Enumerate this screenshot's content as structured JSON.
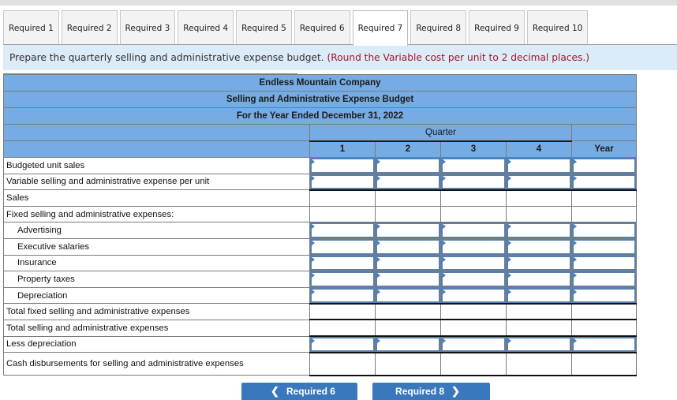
{
  "tabs": [
    {
      "label": "Required 1",
      "active": false
    },
    {
      "label": "Required 2",
      "active": false
    },
    {
      "label": "Required 3",
      "active": false
    },
    {
      "label": "Required 4",
      "active": false
    },
    {
      "label": "Required 5",
      "active": false
    },
    {
      "label": "Required 6",
      "active": false
    },
    {
      "label": "Required 7",
      "active": true
    },
    {
      "label": "Required 8",
      "active": false
    },
    {
      "label": "Required 9",
      "active": false
    },
    {
      "label": "Required 10",
      "active": false
    }
  ],
  "instruction": {
    "text": "Prepare the quarterly selling and administrative expense budget.",
    "note": "(Round the Variable cost per unit to 2 decimal places.)"
  },
  "budget": {
    "company": "Endless Mountain Company",
    "title": "Selling and Administrative Expense Budget",
    "period": "For the Year Ended December 31, 2022",
    "quarter_header": "Quarter",
    "columns": [
      "1",
      "2",
      "3",
      "4",
      "Year"
    ],
    "rows": [
      {
        "label": "Budgeted unit sales",
        "indent": false,
        "input": true,
        "values": [
          "",
          "",
          "",
          "",
          ""
        ]
      },
      {
        "label": "Variable selling and administrative expense per unit",
        "indent": false,
        "input": true,
        "values": [
          "",
          "",
          "",
          "",
          ""
        ]
      },
      {
        "label": "Sales",
        "indent": false,
        "input": false,
        "values": [
          "",
          "",
          "",
          "",
          ""
        ]
      },
      {
        "label": "Fixed selling and administrative expenses:",
        "indent": false,
        "input": false,
        "values": [
          "",
          "",
          "",
          "",
          ""
        ]
      },
      {
        "label": "Advertising",
        "indent": true,
        "input": true,
        "values": [
          "",
          "",
          "",
          "",
          ""
        ]
      },
      {
        "label": "Executive salaries",
        "indent": true,
        "input": true,
        "values": [
          "",
          "",
          "",
          "",
          ""
        ]
      },
      {
        "label": "Insurance",
        "indent": true,
        "input": true,
        "values": [
          "",
          "",
          "",
          "",
          ""
        ]
      },
      {
        "label": "Property taxes",
        "indent": true,
        "input": true,
        "values": [
          "",
          "",
          "",
          "",
          ""
        ]
      },
      {
        "label": "Depreciation",
        "indent": true,
        "input": true,
        "values": [
          "",
          "",
          "",
          "",
          ""
        ]
      },
      {
        "label": "Total fixed selling and administrative expenses",
        "indent": false,
        "input": false,
        "values": [
          "",
          "",
          "",
          "",
          ""
        ]
      },
      {
        "label": "Total selling and administrative expenses",
        "indent": false,
        "input": false,
        "values": [
          "",
          "",
          "",
          "",
          ""
        ]
      },
      {
        "label": "Less depreciation",
        "indent": false,
        "input": true,
        "values": [
          "",
          "",
          "",
          "",
          ""
        ]
      },
      {
        "label": "Cash disbursements for selling and administrative expenses",
        "indent": false,
        "input": false,
        "values": [
          "",
          "",
          "",
          "",
          ""
        ]
      }
    ]
  },
  "nav": {
    "prev_label": "Required 6",
    "next_label": "Required 8",
    "prev_icon": "chevron-left-icon",
    "next_icon": "chevron-right-icon"
  },
  "colors": {
    "header_blue": "#77abe3",
    "instruction_bg": "#dcebf8",
    "note_red": "#a3182a",
    "button_blue": "#3a78be",
    "input_border": "#5a7fab"
  }
}
